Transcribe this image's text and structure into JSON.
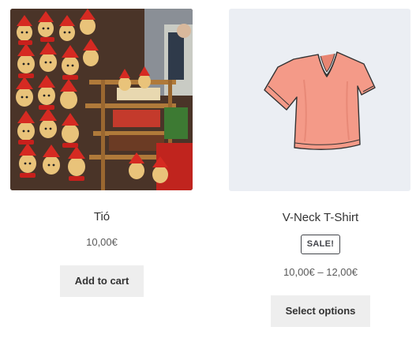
{
  "products": [
    {
      "name": "Tió",
      "price": "10,00€",
      "button_label": "Add to cart"
    },
    {
      "name": "V-Neck T-Shirt",
      "badge": "SALE!",
      "price": "10,00€ – 12,00€",
      "button_label": "Select options"
    }
  ],
  "colors": {
    "button_bg": "#eeeeee",
    "shirt": "#f49a88",
    "shirt_image_bg": "#ebeef3"
  }
}
